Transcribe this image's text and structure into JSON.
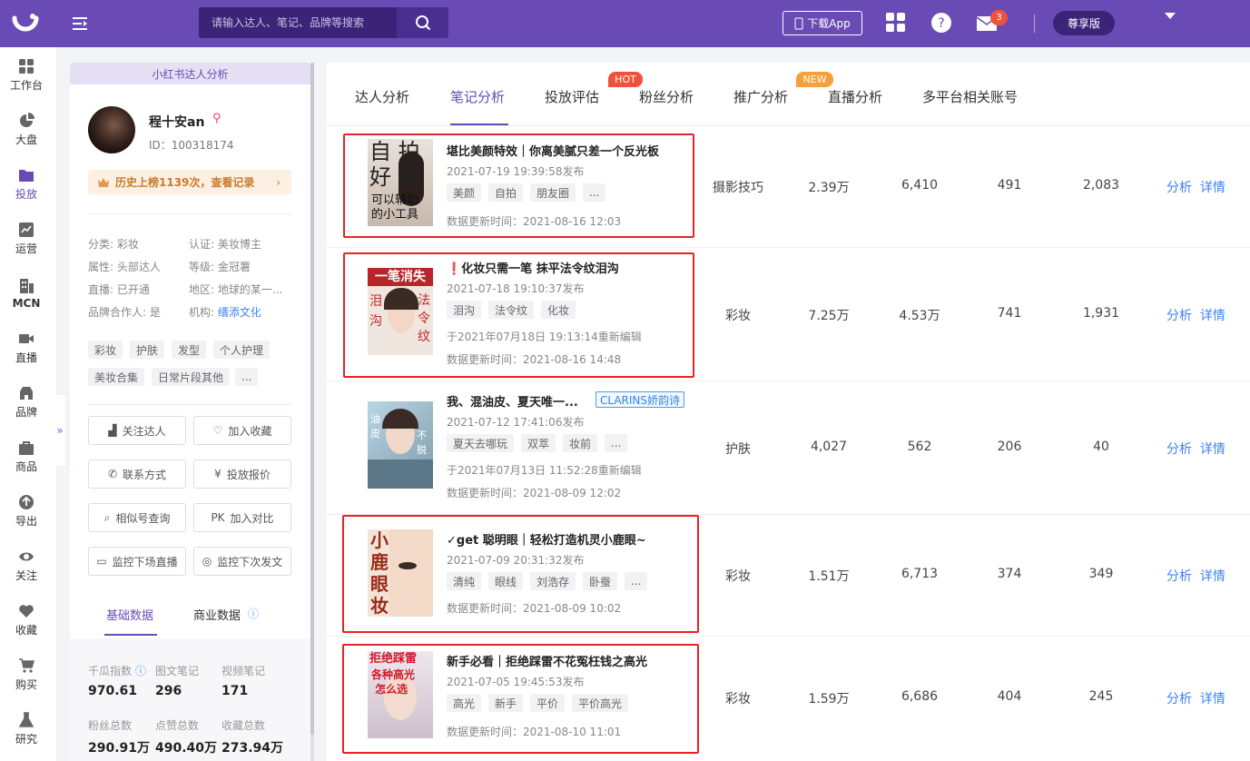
{
  "topbar": {
    "search_placeholder": "请输入达人、笔记、品牌等搜索",
    "download_app": "下载App",
    "message_count": "3",
    "vip_label": "尊享版"
  },
  "sidenav": [
    "工作台",
    "大盘",
    "投放",
    "运营",
    "MCN",
    "直播",
    "品牌",
    "商品",
    "导出",
    "关注",
    "收藏",
    "购买",
    "研究"
  ],
  "profile": {
    "panel_title": "小红书达人分析",
    "name": "程十安an",
    "id": "ID：100318174",
    "rank_text": "历史上榜1139次，查看记录",
    "category_label": "分类:",
    "category": "彩妆",
    "cert_label": "认证:",
    "cert": "美妆博主",
    "attr_label": "属性:",
    "attr": "头部达人",
    "level_label": "等级:",
    "level": "金冠薯",
    "live_label": "直播:",
    "live": "已开通",
    "region_label": "地区:",
    "region": "地球的某一...",
    "brand_label": "品牌合作人:",
    "brand": "是",
    "org_label": "机构:",
    "org": "缙添文化",
    "tags": [
      "彩妆",
      "护肤",
      "发型",
      "个人护理",
      "美妆合集",
      "日常片段其他",
      "..."
    ],
    "buttons": [
      "关注达人",
      "加入收藏",
      "联系方式",
      "投放报价",
      "相似号查询",
      "加入对比",
      "监控下场直播",
      "监控下次发文"
    ],
    "subtabs": [
      "基础数据",
      "商业数据"
    ],
    "stats": [
      {
        "label": "千瓜指数",
        "value": "970.61"
      },
      {
        "label": "图文笔记",
        "value": "296"
      },
      {
        "label": "视频笔记",
        "value": "171"
      },
      {
        "label": "粉丝总数",
        "value": "290.91万"
      },
      {
        "label": "点赞总数",
        "value": "490.40万"
      },
      {
        "label": "收藏总数",
        "value": "273.94万"
      }
    ]
  },
  "tabs": [
    "达人分析",
    "笔记分析",
    "投放评估",
    "粉丝分析",
    "推广分析",
    "直播分析",
    "多平台相关账号"
  ],
  "tab_badges": {
    "hot": "HOT",
    "new": "NEW"
  },
  "notes": [
    {
      "title": "堪比美颜特效｜你离美腻只差一个反光板",
      "date": "2021-07-19 19:39:58发布",
      "tags": [
        "美颜",
        "自拍",
        "朋友圈",
        "..."
      ],
      "edit": "",
      "update": "数据更新时间：2021-08-16 12:03",
      "category": "摄影技巧",
      "v1": "2.39万",
      "v2": "6,410",
      "v3": "491",
      "v4": "2,083",
      "thumb_text": "自拍好看 可以辅助的小工具"
    },
    {
      "title": "❗化妆只需一笔 抹平法令纹泪沟",
      "date": "2021-07-18 19:10:37发布",
      "tags": [
        "泪沟",
        "法令纹",
        "化妆"
      ],
      "edit": "于2021年07月18日 19:13:14重新编辑",
      "update": "数据更新时间：2021-08-16 14:48",
      "category": "彩妆",
      "v1": "7.25万",
      "v2": "4.53万",
      "v3": "741",
      "v4": "1,931",
      "thumb_text": "一笔消失 泪沟 法令纹"
    },
    {
      "title": "我、混油皮、夏天唯一...",
      "brand": "CLARINS娇韵诗",
      "date": "2021-07-12 17:41:06发布",
      "tags": [
        "夏天去哪玩",
        "双萃",
        "妆前",
        "..."
      ],
      "edit": "于2021年07月13日 11:52:28重新编辑",
      "update": "数据更新时间：2021-08-09 12:02",
      "category": "护肤",
      "v1": "4,027",
      "v2": "562",
      "v3": "206",
      "v4": "40",
      "thumb_text": "油 不 皮 脱 妆"
    },
    {
      "title": "✓get 聪明眼｜轻松打造机灵小鹿眼~",
      "date": "2021-07-09 20:31:32发布",
      "tags": [
        "清纯",
        "眼线",
        "刘浩存",
        "卧蚕",
        "..."
      ],
      "edit": "",
      "update": "数据更新时间：2021-08-09 10:02",
      "category": "彩妆",
      "v1": "1.51万",
      "v2": "6,713",
      "v3": "374",
      "v4": "349",
      "thumb_text": "小鹿眼妆"
    },
    {
      "title": "新手必看｜拒绝踩雷不花冤枉钱之高光",
      "date": "2021-07-05 19:45:53发布",
      "tags": [
        "高光",
        "新手",
        "平价",
        "平价高光"
      ],
      "edit": "",
      "update": "数据更新时间：2021-08-10 11:01",
      "category": "彩妆",
      "v1": "1.59万",
      "v2": "6,686",
      "v3": "404",
      "v4": "245",
      "thumb_text": "拒绝踩雷 各种高光怎么选"
    }
  ],
  "actions": {
    "analyze": "分析",
    "detail": "详情"
  }
}
